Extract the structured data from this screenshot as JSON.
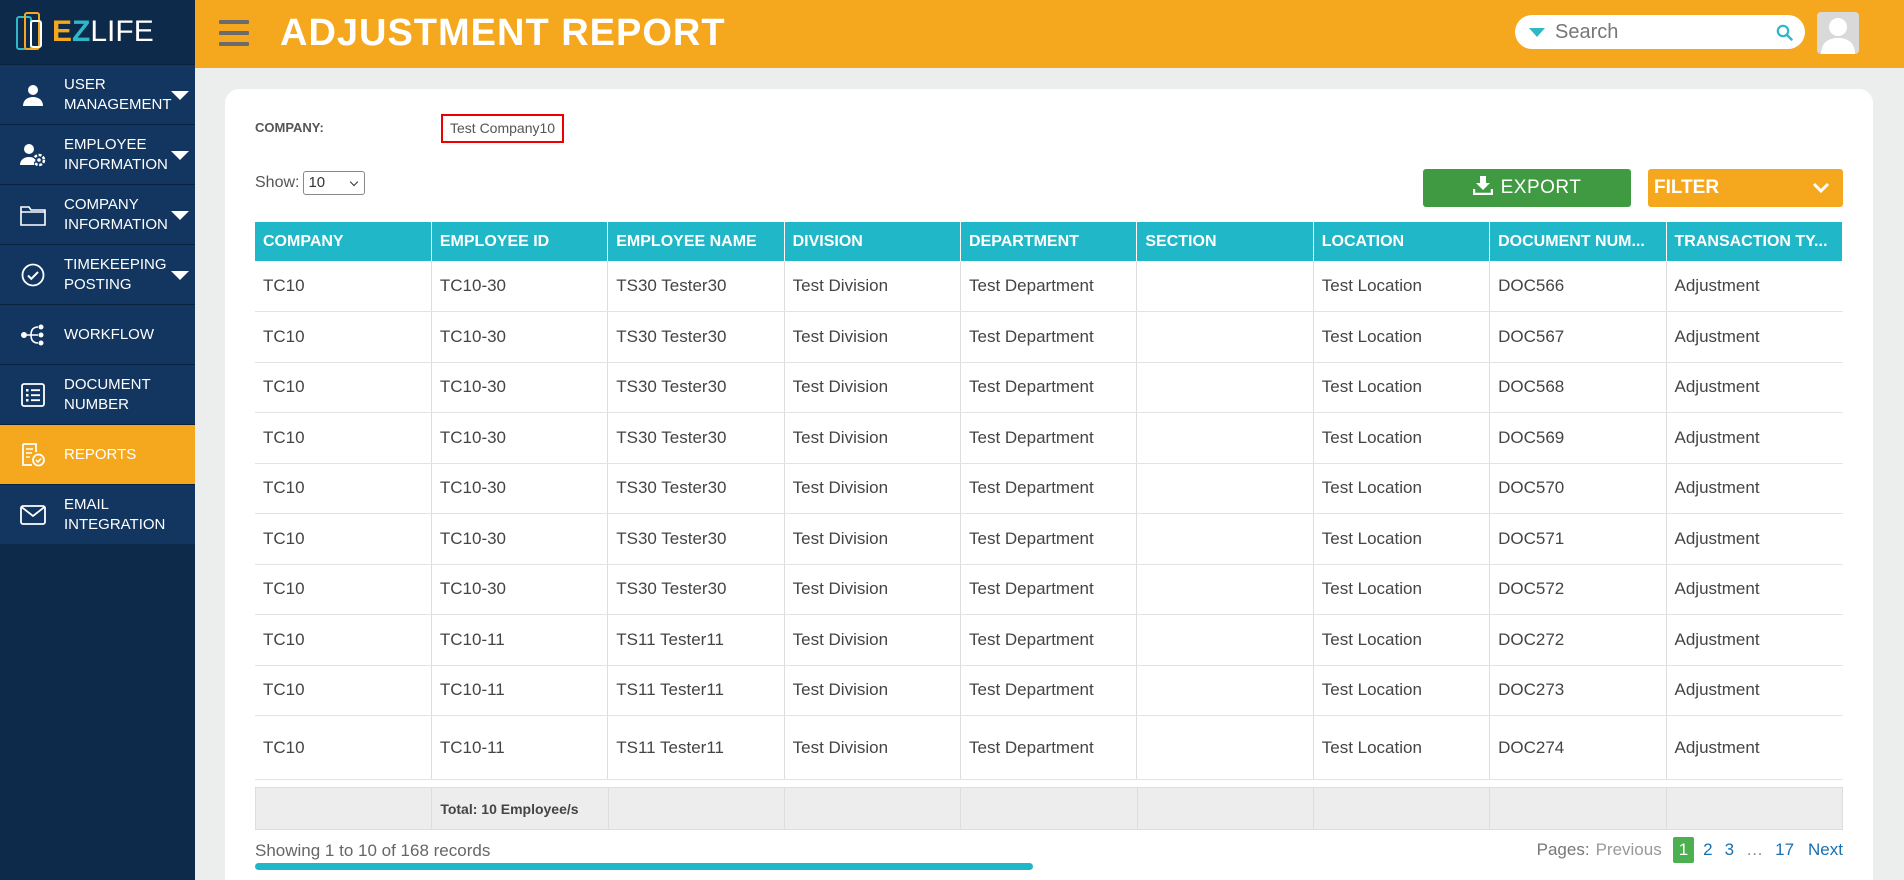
{
  "app": {
    "logo": {
      "ez1": "E",
      "ez2": "Z",
      "life": "LIFE"
    },
    "colors": {
      "accent": "#f5a81e",
      "sidebar": "#0d2a4a",
      "table_header": "#20b7c9",
      "export": "#3f9a41"
    }
  },
  "sidebar": {
    "items": [
      {
        "label": "USER MANAGEMENT",
        "icon": "user-icon",
        "caret": true
      },
      {
        "label": "EMPLOYEE INFORMATION",
        "icon": "user-gear-icon",
        "caret": true
      },
      {
        "label": "COMPANY INFORMATION",
        "icon": "folder-icon",
        "caret": true
      },
      {
        "label": "TIMEKEEPING POSTING",
        "icon": "check-circle-icon",
        "caret": true
      },
      {
        "label": "WORKFLOW",
        "icon": "workflow-icon",
        "caret": false
      },
      {
        "label": "DOCUMENT NUMBER",
        "icon": "list-icon",
        "caret": false
      },
      {
        "label": "REPORTS",
        "icon": "report-icon",
        "caret": false,
        "active": true
      },
      {
        "label": "EMAIL INTEGRATION",
        "icon": "mail-icon",
        "caret": false
      }
    ]
  },
  "header": {
    "title": "ADJUSTMENT REPORT",
    "search_placeholder": "Search"
  },
  "filters": {
    "company_label": "COMPANY:",
    "company_value": "Test Company10",
    "show_label": "Show:",
    "show_value": "10",
    "export_label": "EXPORT",
    "filter_label": "FILTER"
  },
  "table": {
    "columns": [
      "COMPANY",
      "EMPLOYEE ID",
      "EMPLOYEE NAME",
      "DIVISION",
      "DEPARTMENT",
      "SECTION",
      "LOCATION",
      "DOCUMENT NUM...",
      "TRANSACTION TY..."
    ],
    "rows": [
      [
        "TC10",
        "TC10-30",
        "TS30 Tester30",
        "Test Division",
        "Test Department",
        "",
        "Test Location",
        "DOC566",
        "Adjustment"
      ],
      [
        "TC10",
        "TC10-30",
        "TS30 Tester30",
        "Test Division",
        "Test Department",
        "",
        "Test Location",
        "DOC567",
        "Adjustment"
      ],
      [
        "TC10",
        "TC10-30",
        "TS30 Tester30",
        "Test Division",
        "Test Department",
        "",
        "Test Location",
        "DOC568",
        "Adjustment"
      ],
      [
        "TC10",
        "TC10-30",
        "TS30 Tester30",
        "Test Division",
        "Test Department",
        "",
        "Test Location",
        "DOC569",
        "Adjustment"
      ],
      [
        "TC10",
        "TC10-30",
        "TS30 Tester30",
        "Test Division",
        "Test Department",
        "",
        "Test Location",
        "DOC570",
        "Adjustment"
      ],
      [
        "TC10",
        "TC10-30",
        "TS30 Tester30",
        "Test Division",
        "Test Department",
        "",
        "Test Location",
        "DOC571",
        "Adjustment"
      ],
      [
        "TC10",
        "TC10-30",
        "TS30 Tester30",
        "Test Division",
        "Test Department",
        "",
        "Test Location",
        "DOC572",
        "Adjustment"
      ],
      [
        "TC10",
        "TC10-11",
        "TS11 Tester11",
        "Test Division",
        "Test Department",
        "",
        "Test Location",
        "DOC272",
        "Adjustment"
      ],
      [
        "TC10",
        "TC10-11",
        "TS11 Tester11",
        "Test Division",
        "Test Department",
        "",
        "Test Location",
        "DOC273",
        "Adjustment"
      ],
      [
        "TC10",
        "TC10-11",
        "TS11 Tester11",
        "Test Division",
        "Test Department",
        "",
        "Test Location",
        "DOC274",
        "Adjustment"
      ]
    ],
    "total_label": "Total: 10 Employee/s"
  },
  "footer": {
    "showing_text": "Showing 1 to 10 of 168 records",
    "pages_label": "Pages:",
    "previous": "Previous",
    "pages": [
      "1",
      "2",
      "3"
    ],
    "ellipsis": "…",
    "last_page": "17",
    "next": "Next"
  }
}
